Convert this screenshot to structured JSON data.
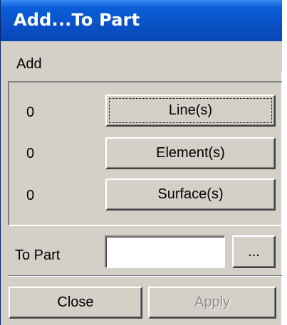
{
  "window": {
    "title": "Add...To Part"
  },
  "menu": {
    "add_label": "Add"
  },
  "entity_rows": [
    {
      "count": "0",
      "button_label": "Line(s)"
    },
    {
      "count": "0",
      "button_label": "Element(s)"
    },
    {
      "count": "0",
      "button_label": "Surface(s)"
    }
  ],
  "to_part": {
    "label": "To Part",
    "value": "",
    "browse_label": "..."
  },
  "footer": {
    "close_label": "Close",
    "apply_label": "Apply"
  }
}
